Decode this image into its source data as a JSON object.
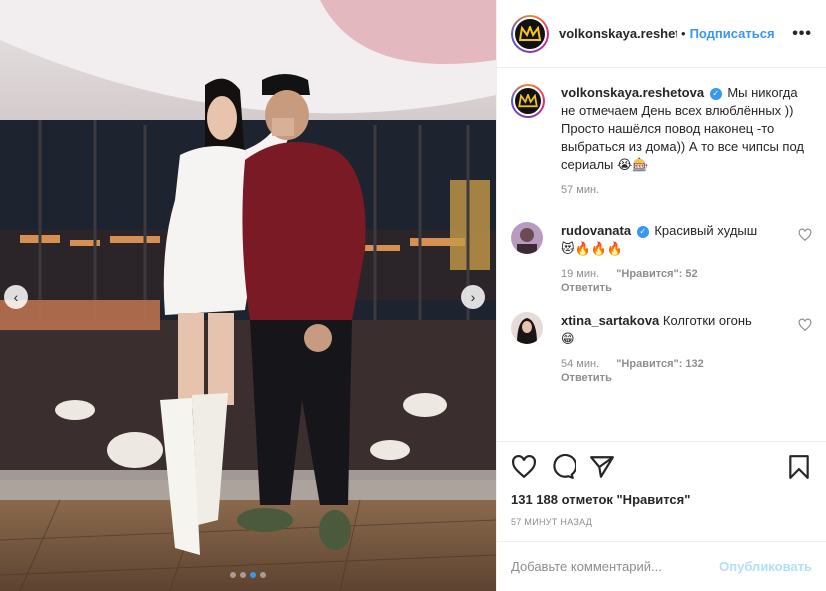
{
  "header": {
    "username": "volkonskaya.reshetova",
    "separator": "•",
    "follow_label": "Подписаться",
    "more_label": "•••"
  },
  "caption": {
    "username": "volkonskaya.reshetova",
    "verified": true,
    "text": "Мы никогда не отмечаем День всех влюблённых )) Просто нашёлся повод наконец -то выбраться из дома)) А то все чипсы под сериалы",
    "emojis": "😭🎰",
    "time": "57 мин."
  },
  "comments": [
    {
      "username": "rudovanata",
      "verified": true,
      "text": "Красивый худыш",
      "emojis": "😻🔥🔥🔥",
      "time": "19 мин.",
      "likes": "\"Нравится\": 52",
      "reply": "Ответить"
    },
    {
      "username": "xtina_sartakova",
      "verified": false,
      "text": "Колготки огонь",
      "emojis": "😁",
      "time": "54 мин.",
      "likes": "\"Нравится\": 132",
      "reply": "Ответить"
    }
  ],
  "post": {
    "likes": "131 188 отметок \"Нравится\"",
    "posted": "57 МИНУТ НАЗАД"
  },
  "add_comment": {
    "placeholder": "Добавьте комментарий...",
    "post_label": "Опубликовать"
  },
  "carousel": {
    "total": 4,
    "active": 3
  },
  "colors": {
    "accent": "#3897f0",
    "post_disabled": "#b2dffc",
    "muted": "#8e8e8e",
    "logo_gold": "#f5c518"
  }
}
